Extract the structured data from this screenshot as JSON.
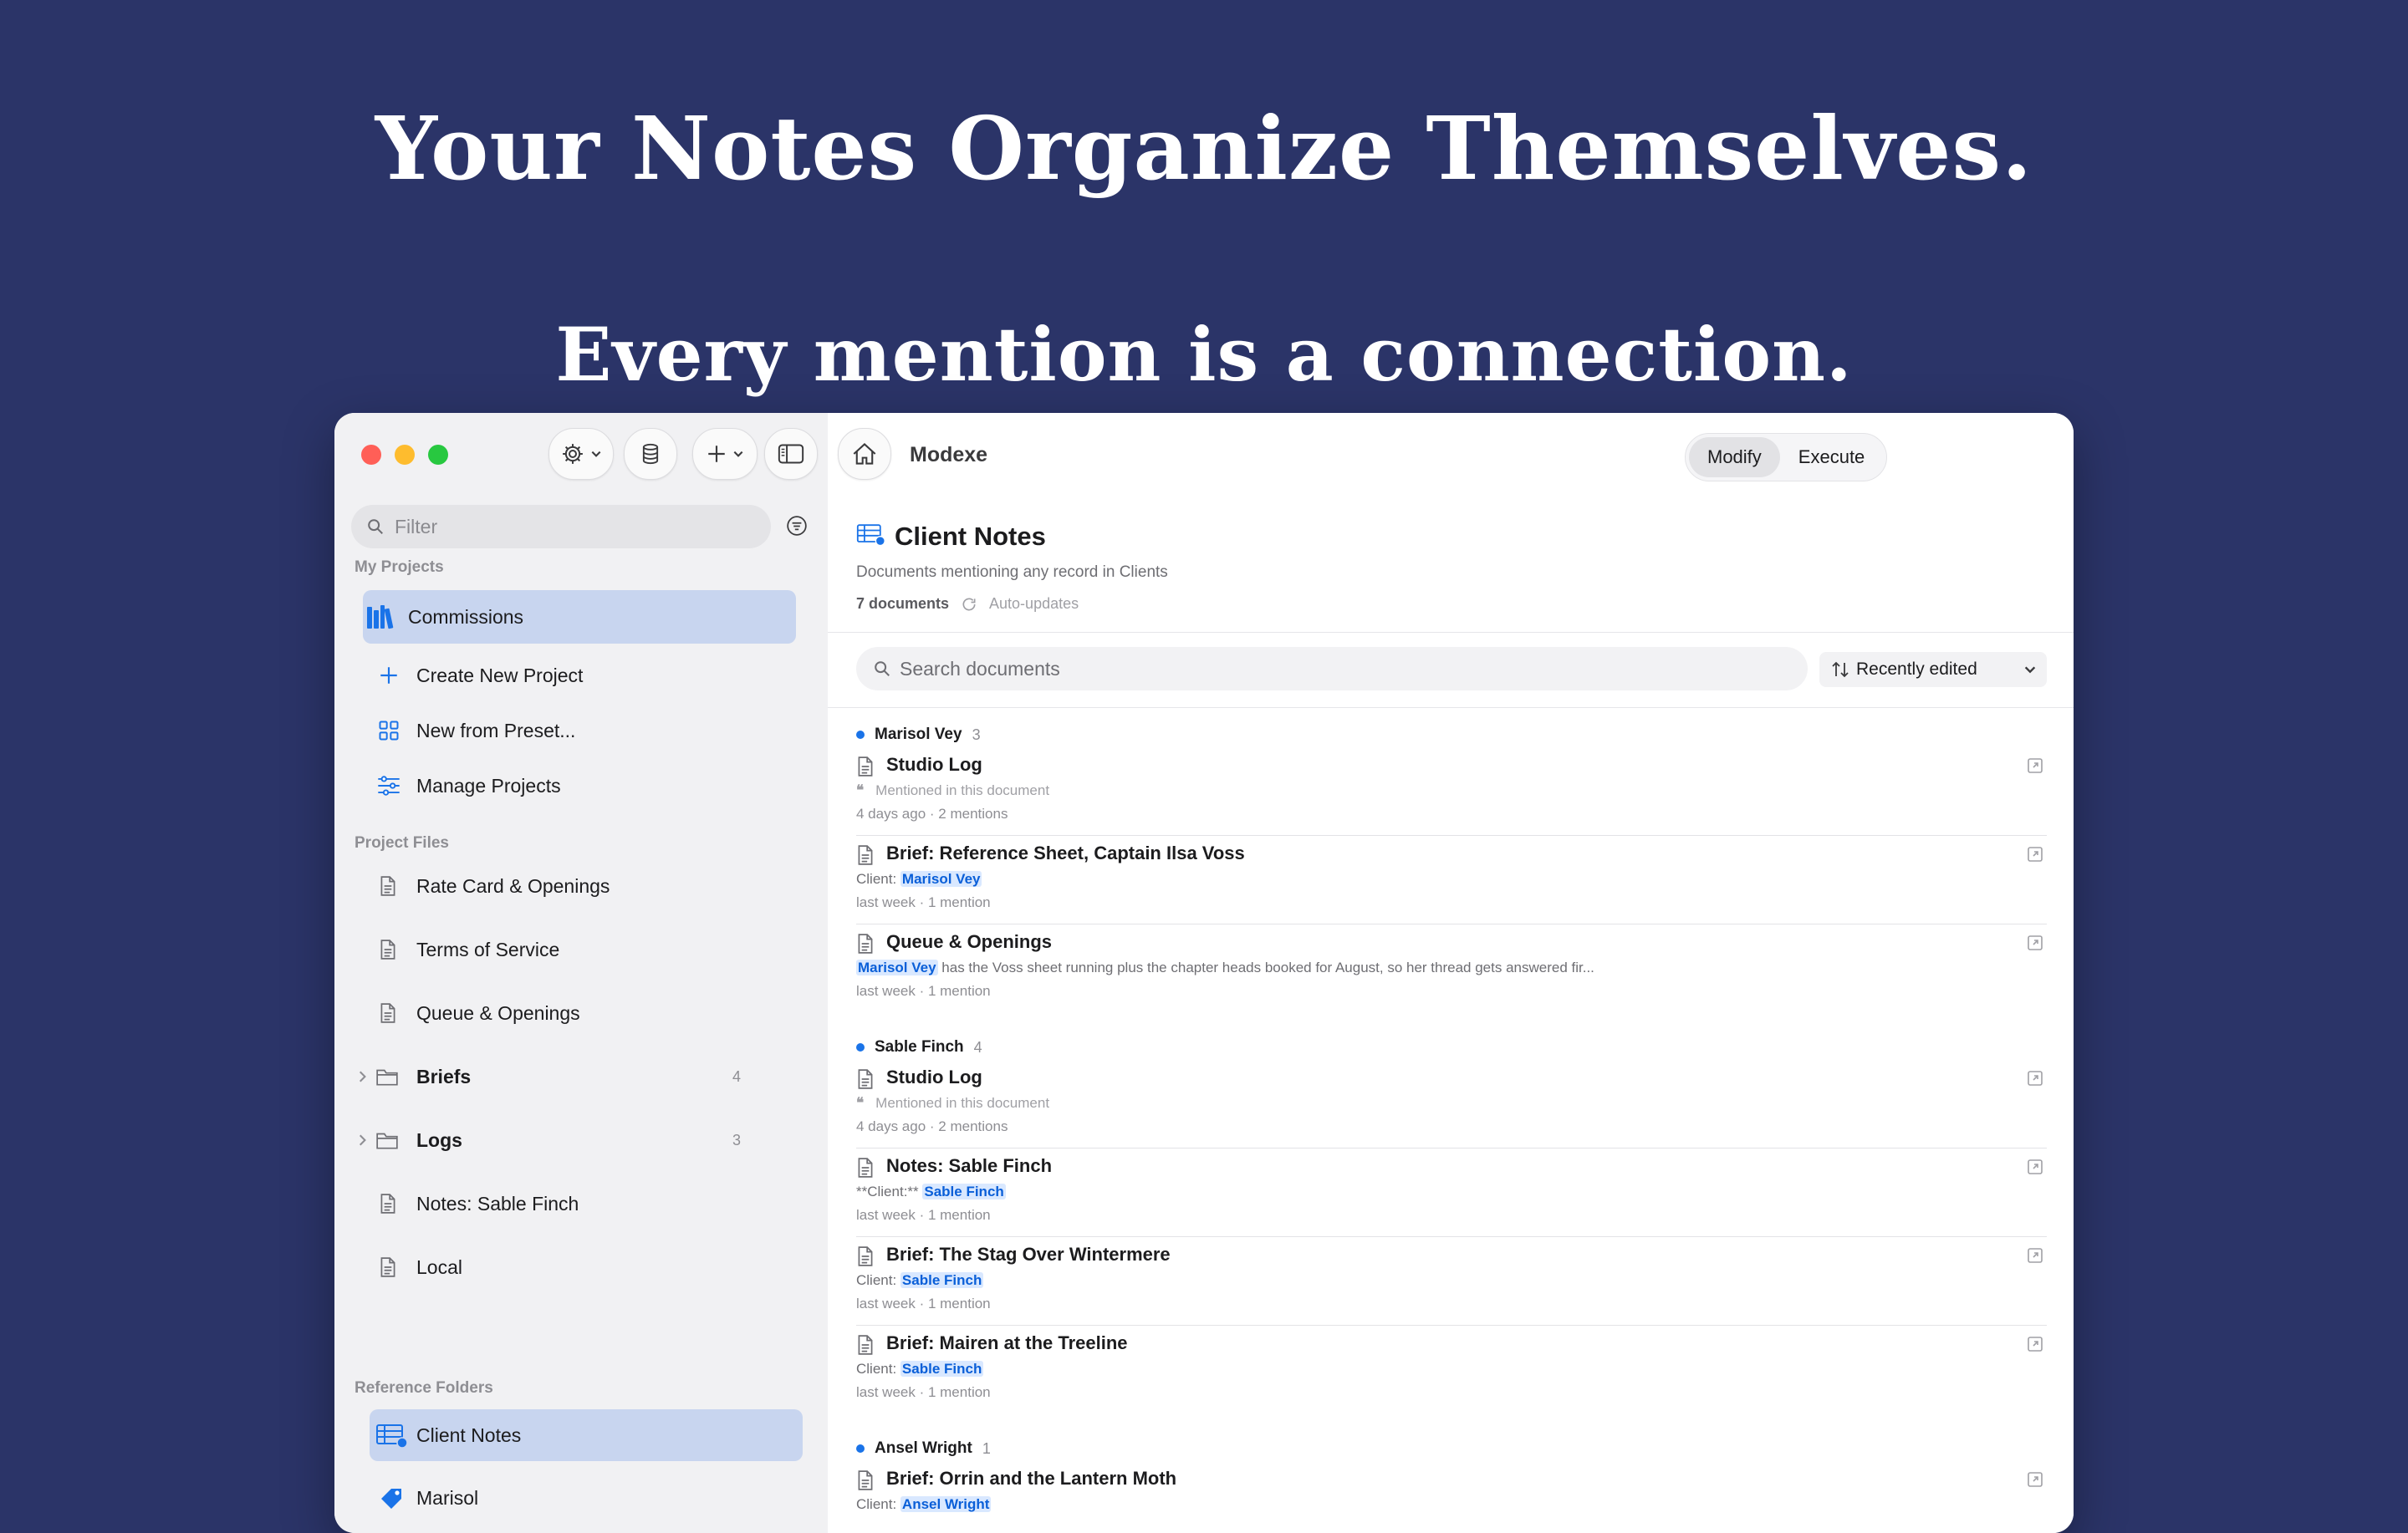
{
  "headline": "Your Notes Organize Themselves.",
  "subheadline": "Every mention is a connection.",
  "colors": {
    "background": "#2b3468",
    "accent": "#1a73e8",
    "selection": "#c8d5ef",
    "highlight": "#d9e8ff"
  },
  "sidebar": {
    "filter_placeholder": "Filter",
    "my_projects_label": "My Projects",
    "selected_project": "Commissions",
    "actions": {
      "create": "Create New Project",
      "preset": "New from Preset...",
      "manage": "Manage Projects"
    },
    "project_files_label": "Project Files",
    "files": {
      "rate_card": "Rate Card & Openings",
      "terms": "Terms of Service",
      "queue": "Queue & Openings",
      "briefs": {
        "label": "Briefs",
        "count": "4"
      },
      "logs": {
        "label": "Logs",
        "count": "3"
      },
      "notes_sable": "Notes: Sable Finch",
      "local": "Local"
    },
    "reference_folders_label": "Reference Folders",
    "references": {
      "client_notes": "Client Notes",
      "marisol": "Marisol"
    }
  },
  "topbar": {
    "title": "Modexe",
    "modes": {
      "modify": "Modify",
      "execute": "Execute",
      "active": "Modify"
    }
  },
  "view": {
    "title": "Client Notes",
    "description": "Documents mentioning any record in Clients",
    "doc_count": "7 documents",
    "auto_updates": "Auto-updates",
    "search_placeholder": "Search documents",
    "sort_label": "Recently edited"
  },
  "groups": {
    "marisol": {
      "name": "Marisol Vey",
      "count": "3",
      "docs": {
        "d1": {
          "title": "Studio Log",
          "line2": "Mentioned in this document",
          "meta": "4 days ago  ·  2 mentions"
        },
        "d2": {
          "title": "Brief: Reference Sheet, Captain Ilsa Voss",
          "prefix": "Client: ",
          "mention": "Marisol Vey",
          "meta": "last week  ·  1 mention"
        },
        "d3": {
          "title": "Queue & Openings",
          "mention": "Marisol Vey",
          "suffix": " has the Voss sheet running plus the chapter heads booked for August, so her thread gets answered fir...",
          "meta": "last week  ·  1 mention"
        }
      }
    },
    "sable": {
      "name": "Sable Finch",
      "count": "4",
      "docs": {
        "d1": {
          "title": "Studio Log",
          "line2": "Mentioned in this document",
          "meta": "4 days ago  ·  2 mentions"
        },
        "d2": {
          "title": "Notes: Sable Finch",
          "prefix": "**Client:** ",
          "mention": "Sable Finch",
          "meta": "last week  ·  1 mention"
        },
        "d3": {
          "title": "Brief: The Stag Over Wintermere",
          "prefix": "Client: ",
          "mention": "Sable Finch",
          "meta": "last week  ·  1 mention"
        },
        "d4": {
          "title": "Brief: Mairen at the Treeline",
          "prefix": "Client: ",
          "mention": "Sable Finch",
          "meta": "last week  ·  1 mention"
        }
      }
    },
    "ansel": {
      "name": "Ansel Wright",
      "count": "1",
      "docs": {
        "d1": {
          "title": "Brief: Orrin and the Lantern Moth",
          "prefix": "Client: ",
          "mention": "Ansel Wright"
        }
      }
    }
  }
}
